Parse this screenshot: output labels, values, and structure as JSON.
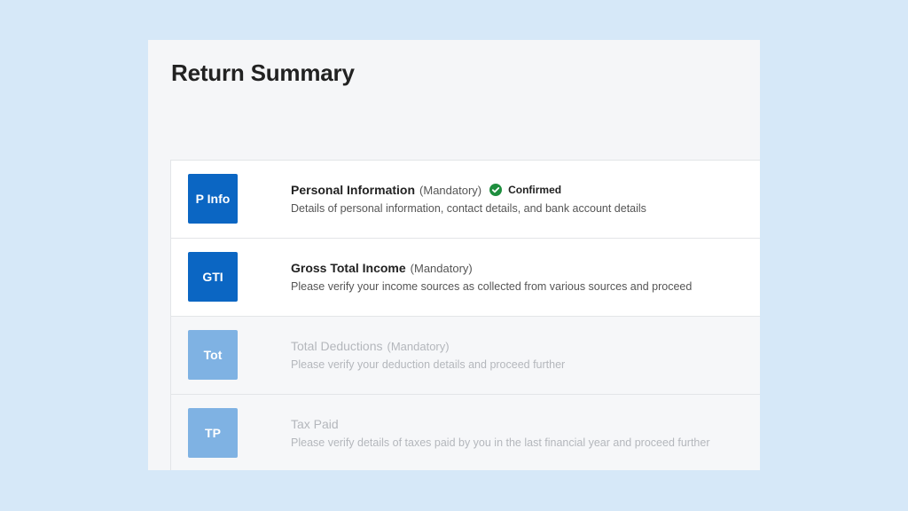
{
  "page": {
    "title": "Return Summary"
  },
  "sections": [
    {
      "badge": "P Info",
      "title": "Personal Information",
      "tag": "(Mandatory)",
      "status": "Confirmed",
      "description": "Details of personal information, contact details, and bank account details",
      "enabled": true
    },
    {
      "badge": "GTI",
      "title": "Gross Total Income",
      "tag": "(Mandatory)",
      "description": "Please verify your income sources as collected from various sources and proceed",
      "enabled": true
    },
    {
      "badge": "Tot",
      "title": "Total Deductions",
      "tag": "(Mandatory)",
      "description": "Please verify your deduction details and proceed further",
      "enabled": false
    },
    {
      "badge": "TP",
      "title": "Tax Paid",
      "description": "Please verify details of taxes paid by you in the last financial year and proceed further",
      "enabled": false
    }
  ],
  "colors": {
    "badge_active": "#0b66c3",
    "badge_disabled": "#7fb2e3",
    "confirmed_green": "#1e8e3e",
    "background": "#d6e8f8"
  },
  "icons": {
    "status": "check-circle-icon"
  }
}
